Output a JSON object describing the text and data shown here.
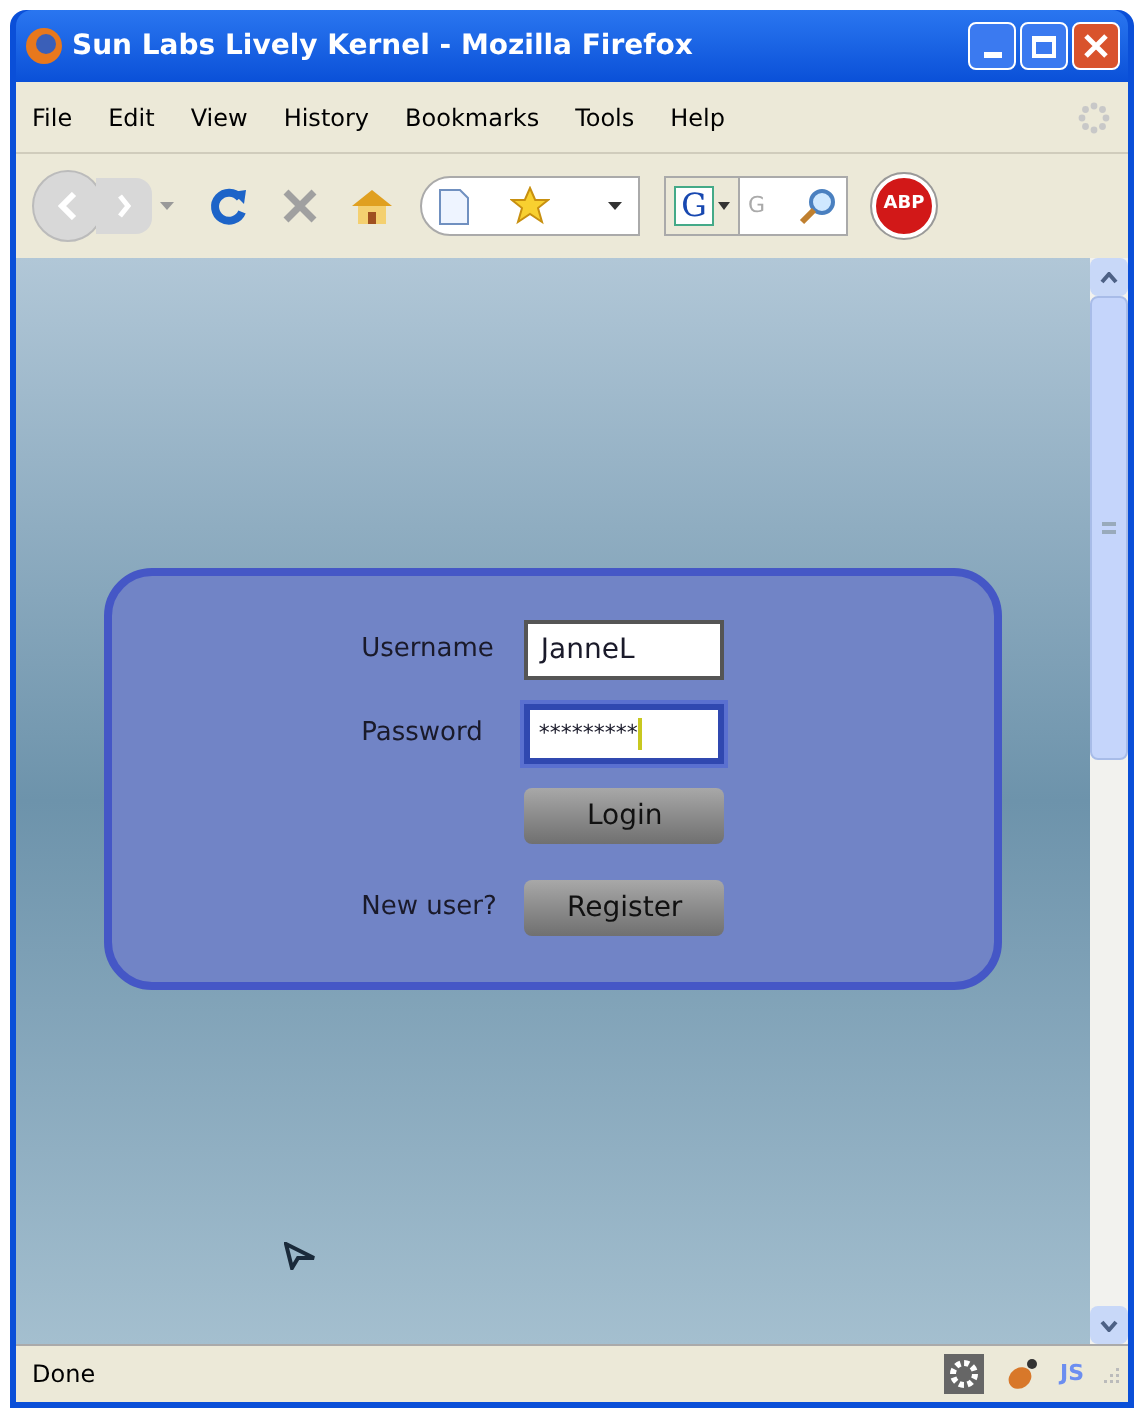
{
  "window": {
    "title": "Sun Labs Lively Kernel - Mozilla Firefox"
  },
  "menu": [
    "File",
    "Edit",
    "View",
    "History",
    "Bookmarks",
    "Tools",
    "Help"
  ],
  "adblock_label": "ABP",
  "search": {
    "engine_label": "G",
    "placeholder": "G"
  },
  "login": {
    "username_label": "Username",
    "username": "JanneL",
    "password_label": "Password",
    "password": "*********",
    "password_focused": true,
    "login_button": "Login",
    "new_user_label": "New user?",
    "register_button": "Register"
  },
  "status_bar": {
    "text": "Done",
    "js_label": "JS"
  }
}
